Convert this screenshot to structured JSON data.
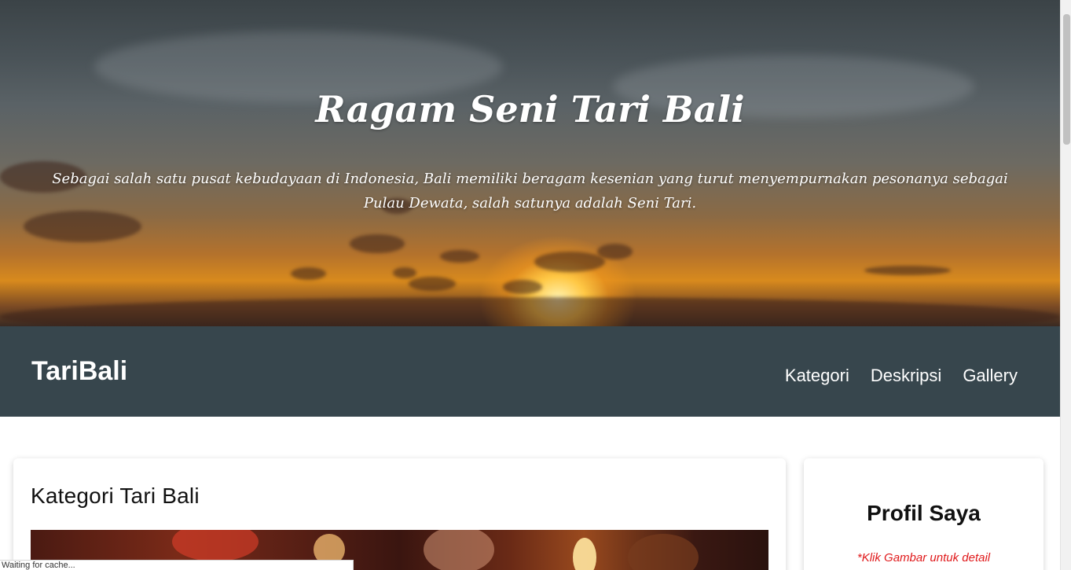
{
  "hero": {
    "title": "Ragam Seni Tari Bali",
    "subtitle": "Sebagai salah satu pusat kebudayaan di Indonesia, Bali memiliki beragam kesenian yang turut menyempurnakan pesonanya sebagai Pulau Dewata, salah satunya adalah Seni Tari."
  },
  "navbar": {
    "brand": "TariBali",
    "links": [
      {
        "label": "Kategori"
      },
      {
        "label": "Deskripsi"
      },
      {
        "label": "Gallery"
      }
    ],
    "background_color": "#37464d"
  },
  "main": {
    "heading": "Kategori Tari Bali"
  },
  "sidebar": {
    "heading": "Profil Saya",
    "hint": "*Klik Gambar untuk detail",
    "hint_color": "#e0191b"
  },
  "status_bar": {
    "text": "Waiting for cache..."
  }
}
